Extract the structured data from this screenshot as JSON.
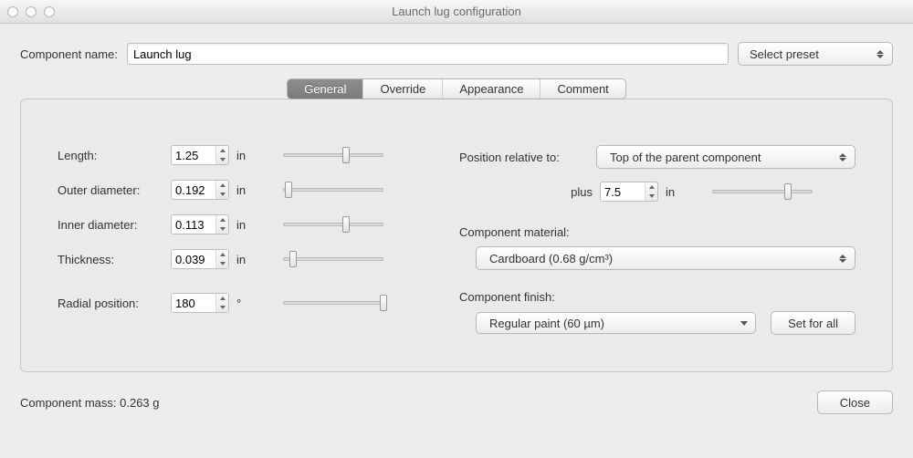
{
  "window": {
    "title": "Launch lug configuration"
  },
  "top": {
    "name_label": "Component name:",
    "name_value": "Launch lug",
    "preset_label": "Select preset"
  },
  "tabs": {
    "general": "General",
    "override": "Override",
    "appearance": "Appearance",
    "comment": "Comment"
  },
  "left": {
    "length": {
      "label": "Length:",
      "value": "1.25",
      "unit": "in",
      "slider": 63
    },
    "outer": {
      "label": "Outer diameter:",
      "value": "0.192",
      "unit": "in",
      "slider": 5
    },
    "inner": {
      "label": "Inner diameter:",
      "value": "0.113",
      "unit": "in",
      "slider": 63
    },
    "thick": {
      "label": "Thickness:",
      "value": "0.039",
      "unit": "in",
      "slider": 10
    },
    "radial": {
      "label": "Radial position:",
      "value": "180",
      "unit": "°",
      "slider": 100
    }
  },
  "right": {
    "pos_label": "Position relative to:",
    "pos_value": "Top of the parent component",
    "plus_label": "plus",
    "plus_value": "7.5",
    "plus_unit": "in",
    "plus_slider": 75,
    "mat_label": "Component material:",
    "mat_value": "Cardboard (0.68 g/cm³)",
    "fin_label": "Component finish:",
    "fin_value": "Regular paint (60 µm)",
    "set_all": "Set for all"
  },
  "footer": {
    "mass_label": "Component mass:",
    "mass_value": "0.263 g",
    "close": "Close"
  }
}
